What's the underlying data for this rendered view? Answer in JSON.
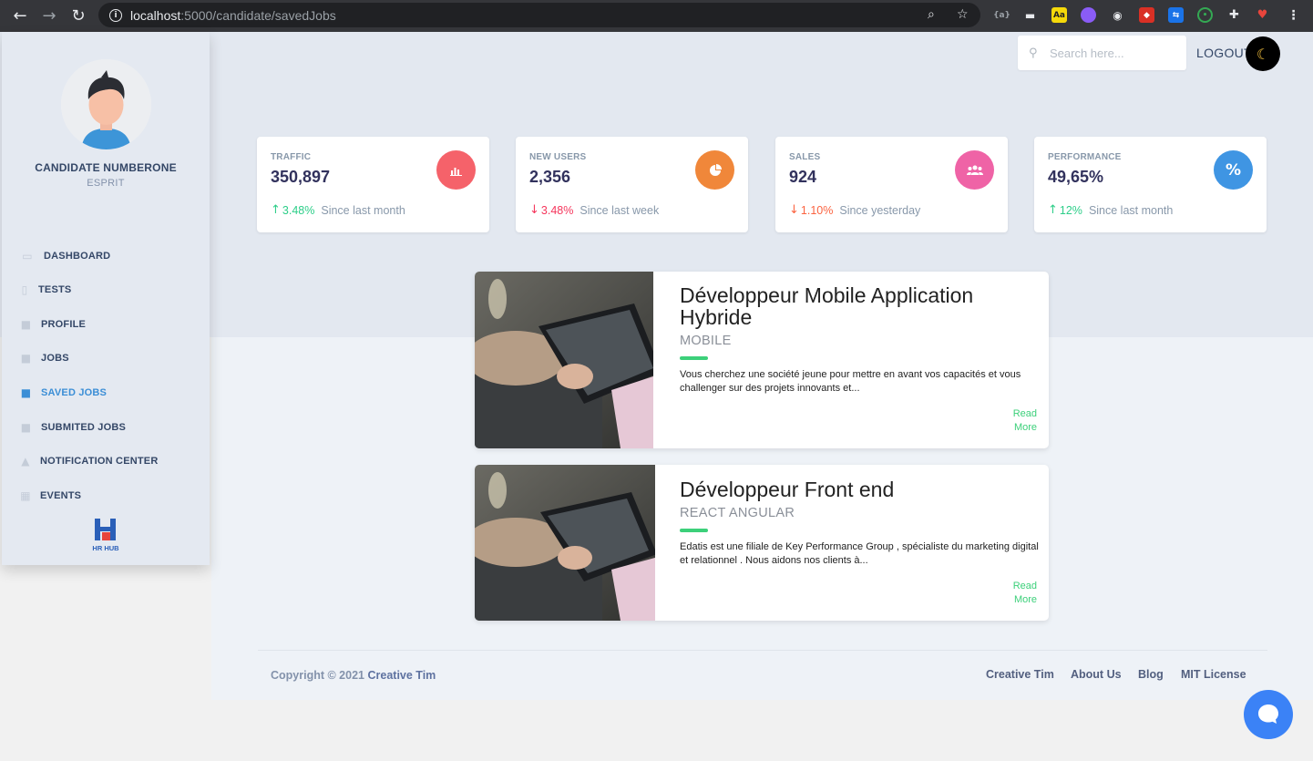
{
  "browser": {
    "url_host": "localhost",
    "url_path": ":5000/candidate/savedJobs"
  },
  "sidebar": {
    "name": "CANDIDATE NUMBERONE",
    "org": "ESPRIT",
    "items": [
      {
        "label": "DASHBOARD"
      },
      {
        "label": "TESTS"
      },
      {
        "label": "PROFILE"
      },
      {
        "label": "JOBS"
      },
      {
        "label": "SAVED JOBS"
      },
      {
        "label": "SUBMITED JOBS"
      },
      {
        "label": "NOTIFICATION CENTER"
      },
      {
        "label": "EVENTS"
      }
    ],
    "logo_text": "HR HUB"
  },
  "header": {
    "search_placeholder": "Search here...",
    "logout_label": "LOGOUT"
  },
  "stats": [
    {
      "label": "TRAFFIC",
      "value": "350,897",
      "change": "3.48%",
      "since": "Since last month",
      "direction": "up",
      "color": "#f5365c"
    },
    {
      "label": "NEW USERS",
      "value": "2,356",
      "change": "3.48%",
      "since": "Since last week",
      "direction": "down",
      "color": "#fb6340"
    },
    {
      "label": "SALES",
      "value": "924",
      "change": "1.10%",
      "since": "Since yesterday",
      "direction": "down",
      "color": "#f3a4b5"
    },
    {
      "label": "PERFORMANCE",
      "value": "49,65%",
      "change": "12%",
      "since": "Since last month",
      "direction": "up",
      "color": "#11cdef"
    }
  ],
  "jobs": [
    {
      "title": "Développeur Mobile Application Hybride",
      "category": "MOBILE",
      "description": "Vous cherchez une société jeune pour mettre en avant vos capacités et vous challenger sur des projets innovants et...",
      "read_more": "Read More"
    },
    {
      "title": "Développeur Front end",
      "category": "REACT ANGULAR",
      "description": "Edatis est une filiale de Key Performance Group , spécialiste du marketing digital et relationnel . Nous aidons nos clients à...",
      "read_more": "Read More"
    }
  ],
  "footer": {
    "copyright_prefix": "Copyright © 2021",
    "copyright_brand": "Creative Tim",
    "links": [
      "Creative Tim",
      "About Us",
      "Blog",
      "MIT License"
    ]
  }
}
